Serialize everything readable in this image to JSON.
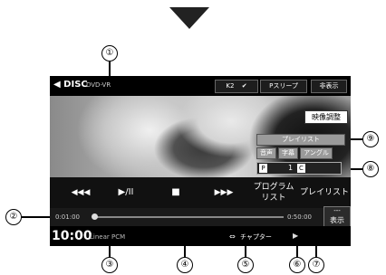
{
  "disc_bar": {
    "source": "◀ DISC",
    "format": "DVD-VR",
    "k2": "K2",
    "sleep": "Pスリープ",
    "hide": "非表示"
  },
  "overlay": {
    "video_adjust": "映像調整",
    "playlist_tag": "プレイリスト",
    "audio": "音声",
    "subtitle": "字幕",
    "angle": "アングル",
    "p_letter": "P",
    "p_number": "1",
    "c_letter": "C"
  },
  "controls": {
    "prev": "◀◀◀",
    "play_pause": "▶/II",
    "stop": "■",
    "next": "▶▶▶",
    "program_list": "プログラム\nリスト",
    "playlist": "プレイリスト"
  },
  "seek": {
    "elapsed": "0:01:00",
    "total": "0:50:00",
    "display_icon": "---",
    "display_label": "表示"
  },
  "status": {
    "clock": "10:00",
    "audio_format": "Linear PCM",
    "chapter_icon": "⇔",
    "chapter": "チャプター",
    "play_icon": "▶"
  },
  "callouts": [
    "①",
    "②",
    "③",
    "④",
    "⑤",
    "⑥",
    "⑦",
    "⑧",
    "⑨"
  ]
}
